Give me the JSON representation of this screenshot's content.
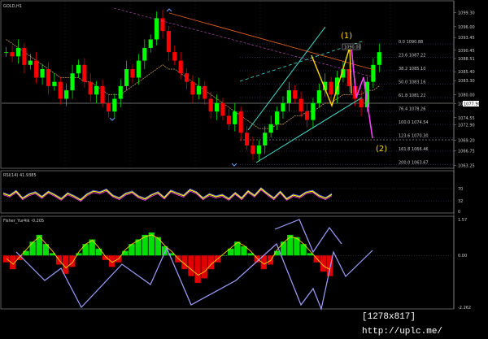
{
  "chart_data": [
    {
      "type": "candlestick",
      "title": "GOLD,H1",
      "series": [
        {
          "name": "price",
          "values": [
            1090,
            1089,
            1091,
            1087,
            1088,
            1084,
            1086,
            1082,
            1083,
            1079,
            1081,
            1085,
            1087,
            1083,
            1080,
            1082,
            1078,
            1076,
            1079,
            1082,
            1086,
            1084,
            1088,
            1091,
            1093,
            1098,
            1095,
            1090,
            1088,
            1085,
            1083,
            1080,
            1082,
            1079,
            1076,
            1078,
            1075,
            1073,
            1076,
            1071,
            1068,
            1066,
            1068,
            1071,
            1073,
            1076,
            1078,
            1081,
            1079,
            1076,
            1074,
            1078,
            1081,
            1083,
            1080,
            1084,
            1086,
            1082,
            1079,
            1077,
            1083,
            1087,
            1090
          ]
        },
        {
          "name": "ma",
          "values": [
            1093,
            1092,
            1091,
            1090,
            1089,
            1088,
            1087,
            1086,
            1085,
            1084,
            1084,
            1084,
            1084,
            1083,
            1083,
            1082,
            1081,
            1080,
            1080,
            1080,
            1081,
            1082,
            1083,
            1084,
            1085,
            1086,
            1087,
            1086,
            1086,
            1085,
            1084,
            1083,
            1082,
            1081,
            1080,
            1079,
            1078,
            1077,
            1076,
            1075,
            1074,
            1073,
            1072,
            1072,
            1072,
            1073,
            1073,
            1074,
            1075,
            1075,
            1076,
            1076,
            1077,
            1078,
            1078,
            1079,
            1080,
            1080,
            1080,
            1080,
            1081,
            1081,
            1082
          ]
        }
      ],
      "yticks": [
        "1099.30",
        "1096.00",
        "1093.45",
        "1090.45",
        "1088.51",
        "1085.40",
        "1083.30",
        "1080.00",
        "1077.90",
        "1074.55",
        "1072.90",
        "1069.20",
        "1066.75",
        "1063.25"
      ],
      "fib_labels": [
        "0.0 1090.88",
        "23.6 1087.22",
        "38.2 1085.10",
        "50.0 1083.16",
        "61.8 1081.22",
        "76.4 1078.26",
        "100.0 1074.54",
        "123.6 1070.30",
        "161.8 1066.46",
        "200.0 1063.67"
      ],
      "price_tag": "1090.00",
      "current_price": "1077.90",
      "wave_labels": [
        "(1)",
        "(2)"
      ],
      "ylim": [
        1063,
        1100
      ]
    },
    {
      "type": "line",
      "title": "RSI(14) 41.9385",
      "ylim": [
        0,
        100
      ],
      "yticks": [
        "70",
        "32",
        "0"
      ],
      "series": [
        {
          "name": "RSI",
          "values": [
            55,
            48,
            62,
            40,
            52,
            58,
            44,
            60,
            50,
            38,
            55,
            46,
            35,
            52,
            62,
            58,
            66,
            48,
            40,
            54,
            60,
            45,
            38,
            50,
            58,
            42,
            63,
            55,
            48,
            66,
            58,
            40,
            52,
            45,
            50,
            38,
            56,
            40,
            62,
            48,
            70,
            54,
            40,
            60,
            38,
            50,
            45,
            58,
            62,
            48,
            40,
            52
          ]
        }
      ]
    },
    {
      "type": "bar",
      "title": "Fisher_Yur4ik -0.205",
      "ylim": [
        -2.262,
        1.57
      ],
      "yticks": [
        "1.57",
        "0.00",
        "-2.262"
      ],
      "series": [
        {
          "name": "Fisher",
          "values": [
            -0.3,
            -0.6,
            -0.2,
            0.2,
            0.6,
            0.9,
            0.5,
            0.1,
            -0.4,
            -0.8,
            -0.5,
            0.1,
            0.5,
            0.7,
            0.3,
            -0.2,
            -0.5,
            -0.3,
            0.2,
            0.5,
            0.7,
            0.9,
            1.0,
            0.8,
            0.4,
            0.1,
            -0.3,
            -0.6,
            -0.9,
            -1.2,
            -1.0,
            -0.6,
            -0.3,
            0.0,
            0.3,
            0.6,
            0.4,
            0.1,
            -0.3,
            -0.6,
            -0.4,
            0.2,
            0.6,
            0.9,
            0.8,
            0.5,
            0.1,
            -0.3,
            -0.7,
            -0.9
          ]
        }
      ]
    }
  ],
  "footer": {
    "text": "[1278x817] http://uplc.me/"
  },
  "colors": {
    "background": "#000000",
    "up": "#00ff00",
    "down": "#ff0000",
    "ma": "#c8a060",
    "channel": "#40e0d0",
    "wave": "#ffd700",
    "forecast": "#ff40ff",
    "rsi": "#ffff00",
    "fisher_pos": "#00e000",
    "fisher_neg": "#e00000",
    "zigzag": "#a0a0ff"
  }
}
